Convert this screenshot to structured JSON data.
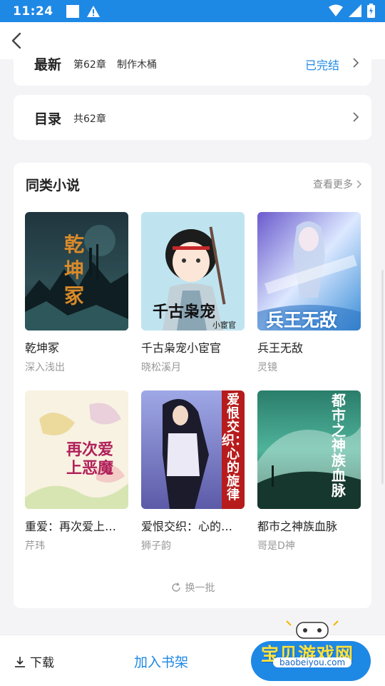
{
  "status_bar": {
    "time": "11:24"
  },
  "latest": {
    "label": "最新",
    "chapter": "第62章",
    "chapter_title": "制作木桶",
    "status": "已完结"
  },
  "toc": {
    "label": "目录",
    "count": "共62章"
  },
  "similar": {
    "title": "同类小说",
    "more": "查看更多",
    "books": [
      {
        "title": "乾坤冢",
        "author": "深入浅出",
        "cover_text": "乾坤冢"
      },
      {
        "title": "千古枭宠小宦官",
        "author": "晓松溪月",
        "cover_text": "千古枭宠",
        "cover_text2": "小宦官"
      },
      {
        "title": "兵王无敌",
        "author": "灵镜",
        "cover_text": "兵王无敌"
      },
      {
        "title": "重爱：再次爱上…",
        "author": "芹玮",
        "cover_text": "再次爱上恶魔"
      },
      {
        "title": "爱恨交织：心的…",
        "author": "狮子韵",
        "cover_text": "爱恨交织：心的旋律"
      },
      {
        "title": "都市之神族血脉",
        "author": "哥是D神",
        "cover_text": "都市之神族血脉"
      }
    ],
    "refresh": "换一批"
  },
  "bottom": {
    "download": "下载",
    "add_shelf": "加入书架",
    "read": ""
  },
  "watermark": {
    "text": "宝贝游戏网",
    "url": "baobeiyou.com"
  },
  "colors": {
    "accent": "#1e88e5",
    "background": "#f4f4f6"
  }
}
